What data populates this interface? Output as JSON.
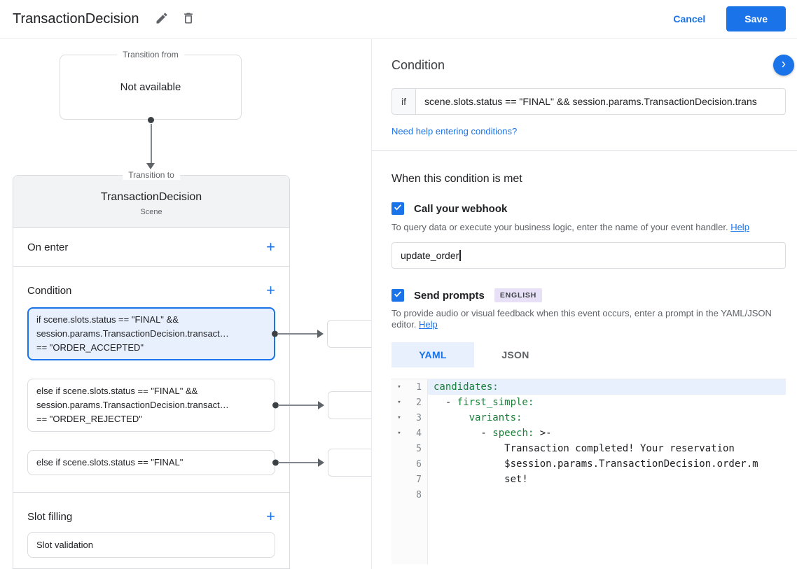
{
  "header": {
    "title": "TransactionDecision",
    "cancel_label": "Cancel",
    "save_label": "Save"
  },
  "diagram": {
    "transition_from": {
      "label": "Transition from",
      "content": "Not available"
    },
    "transition_to": {
      "label": "Transition to",
      "title": "TransactionDecision",
      "subtitle": "Scene"
    },
    "sections": {
      "on_enter": "On enter",
      "condition": "Condition",
      "slot_filling": "Slot filling",
      "slot_validation": "Slot validation"
    },
    "condition_cards": [
      {
        "selected": true,
        "lines": [
          "if scene.slots.status == \"FINAL\" &&",
          "session.params.TransactionDecision.transact…",
          "== \"ORDER_ACCEPTED\""
        ]
      },
      {
        "selected": false,
        "lines": [
          "else if scene.slots.status == \"FINAL\" &&",
          "session.params.TransactionDecision.transact…",
          "== \"ORDER_REJECTED\""
        ]
      },
      {
        "selected": false,
        "lines": [
          "else if scene.slots.status == \"FINAL\""
        ]
      }
    ]
  },
  "panel": {
    "title": "Condition",
    "if_label": "if",
    "expression": "scene.slots.status == \"FINAL\" && session.params.TransactionDecision.trans",
    "help_link": "Need help entering conditions?",
    "when_met_title": "When this condition is met",
    "webhook": {
      "label": "Call your webhook",
      "description": "To query data or execute your business logic, enter the name of your event handler. ",
      "help_label": "Help",
      "value": "update_order"
    },
    "prompts": {
      "label": "Send prompts",
      "badge": "ENGLISH",
      "description": "To provide audio or visual feedback when this event occurs, enter a prompt in the YAML/JSON editor. ",
      "help_label": "Help",
      "tab_yaml": "YAML",
      "tab_json": "JSON"
    }
  },
  "editor": {
    "lines": [
      {
        "num": "1",
        "tokens": [
          {
            "t": "candidates:",
            "c": "key"
          }
        ]
      },
      {
        "num": "2",
        "tokens": [
          {
            "t": "  - ",
            "c": "plain"
          },
          {
            "t": "first_simple:",
            "c": "key"
          }
        ]
      },
      {
        "num": "3",
        "tokens": [
          {
            "t": "      ",
            "c": "plain"
          },
          {
            "t": "variants:",
            "c": "key"
          }
        ]
      },
      {
        "num": "4",
        "tokens": [
          {
            "t": "        - ",
            "c": "plain"
          },
          {
            "t": "speech:",
            "c": "key"
          },
          {
            "t": " >-",
            "c": "plain"
          }
        ]
      },
      {
        "num": "5",
        "tokens": [
          {
            "t": "            Transaction completed! Your reservation",
            "c": "plain"
          }
        ]
      },
      {
        "num": "6",
        "tokens": [
          {
            "t": "            $session.params.TransactionDecision.order.m",
            "c": "plain"
          }
        ]
      },
      {
        "num": "7",
        "tokens": [
          {
            "t": "            set!",
            "c": "plain"
          }
        ]
      },
      {
        "num": "8",
        "tokens": []
      }
    ]
  },
  "icons": {
    "add_glyph": "+",
    "fold_glyph": "▾",
    "edit": "pencil-icon",
    "delete": "trash-icon",
    "expand": "chevron-right-icon",
    "checked": "check-icon"
  },
  "colors": {
    "accent": "#1a73e8",
    "selected_bg": "#e8f0fe",
    "key_green": "#188038",
    "border": "#dadce0",
    "badge_bg": "#e7e0f6"
  }
}
